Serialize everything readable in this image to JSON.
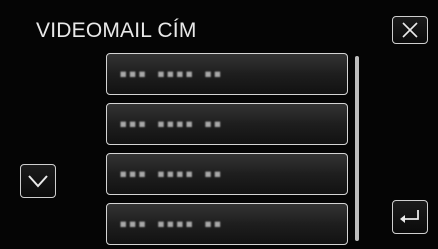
{
  "header": {
    "title": "VIDEOMAIL CÍM"
  },
  "buttons": {
    "close_icon": "close-icon",
    "scroll_down_icon": "chevron-down-icon",
    "back_icon": "return-icon"
  },
  "address_list": [
    {
      "label": "▪▪▪ ▪▪▪▪ ▪▪"
    },
    {
      "label": "▪▪▪ ▪▪▪▪ ▪▪"
    },
    {
      "label": "▪▪▪ ▪▪▪▪ ▪▪"
    },
    {
      "label": "▪▪▪ ▪▪▪▪ ▪▪"
    }
  ]
}
